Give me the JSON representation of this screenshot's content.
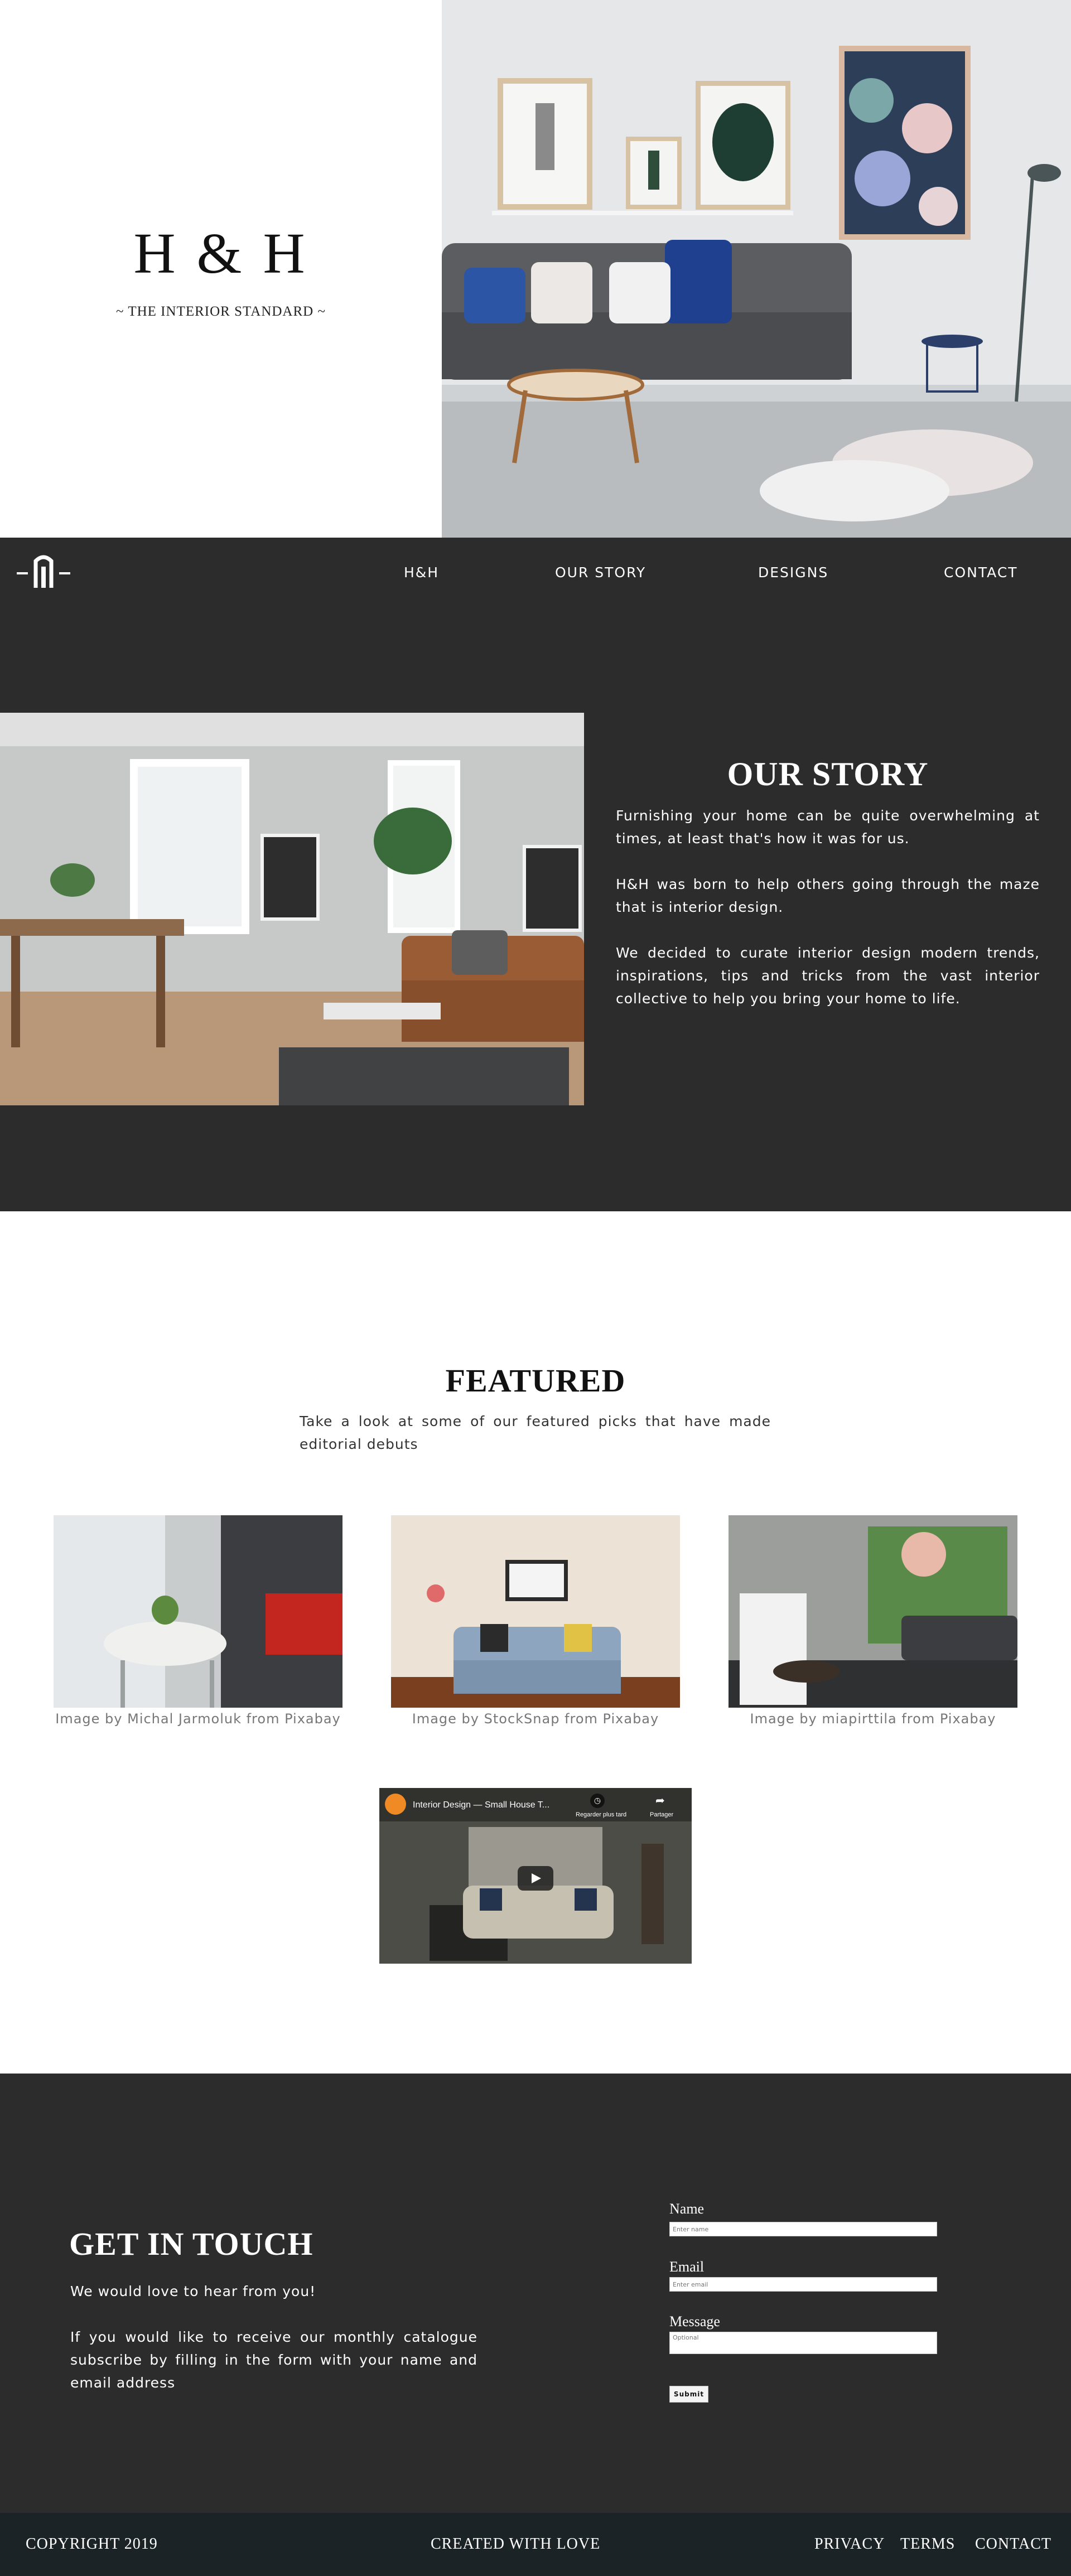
{
  "hero": {
    "title": "H & H",
    "tagline": "~ THE INTERIOR STANDARD ~"
  },
  "nav": {
    "logo": "logo-icon",
    "items": [
      {
        "label": "H&H"
      },
      {
        "label": "OUR STORY"
      },
      {
        "label": "DESIGNS"
      },
      {
        "label": "CONTACT"
      }
    ]
  },
  "story": {
    "title": "OUR STORY",
    "paragraphs": [
      "Furnishing your home can be quite overwhelming at times, at least that's how it was for us.",
      "H&H was born to help others going through the maze that is interior design.",
      "We decided to curate interior design modern trends, inspirations, tips and tricks from the vast interior collective to help you bring your home to life."
    ]
  },
  "featured": {
    "title": "FEATURED",
    "subtitle": "Take a look at some of our featured picks that have made editorial debuts",
    "gallery": [
      {
        "caption": "Image by Michal Jarmoluk from Pixabay"
      },
      {
        "caption": "Image by StockSnap from Pixabay"
      },
      {
        "caption": "Image by miapirttila from Pixabay"
      }
    ],
    "video": {
      "title": "Interior Design — Small House T...",
      "watch_later": "Regarder plus tard",
      "share": "Partager"
    }
  },
  "contact": {
    "title": "GET IN TOUCH",
    "paragraphs": [
      "We would love to hear from you!",
      "If you would like to receive our monthly catalogue subscribe by filling in the form with your name and email address"
    ],
    "form": {
      "name_label": "Name",
      "name_placeholder": "Enter name",
      "email_label": "Email",
      "email_placeholder": "Enter email",
      "message_label": "Message",
      "message_placeholder": "Optional",
      "submit_label": "Submit"
    }
  },
  "footer": {
    "copyright": "COPYRIGHT 2019",
    "created": "CREATED WITH LOVE",
    "links": [
      {
        "label": "PRIVACY"
      },
      {
        "label": "TERMS"
      },
      {
        "label": "CONTACT"
      }
    ]
  },
  "colors": {
    "dark_section": "#2c2c2c",
    "footer": "#1c2326",
    "text_light": "#ffffff"
  }
}
